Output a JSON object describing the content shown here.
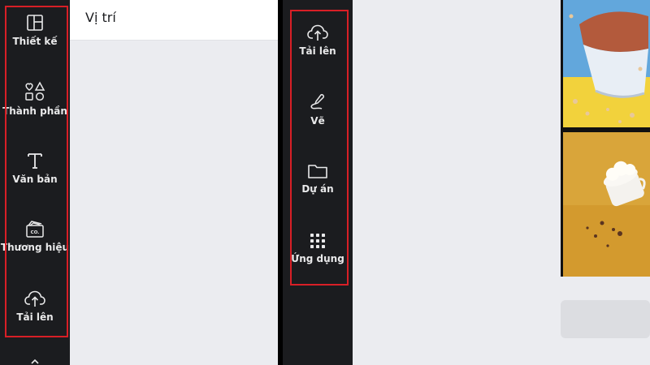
{
  "left_panel": {
    "rail_items": [
      {
        "label": "Thiết kế",
        "icon": "layout-icon"
      },
      {
        "label": "Thành phần",
        "icon": "shapes-icon"
      },
      {
        "label": "Văn bản",
        "icon": "text-icon"
      },
      {
        "label": "Thương hiệu",
        "icon": "brand-icon"
      },
      {
        "label": "Tải lên",
        "icon": "upload-cloud-icon"
      }
    ],
    "location_title": "Vị trí"
  },
  "right_panel": {
    "rail_items": [
      {
        "label": "Tải lên",
        "icon": "upload-cloud-icon"
      },
      {
        "label": "Vẽ",
        "icon": "draw-icon"
      },
      {
        "label": "Dự án",
        "icon": "folder-icon"
      },
      {
        "label": "Ứng dụng",
        "icon": "apps-grid-icon"
      }
    ]
  },
  "colors": {
    "rail_bg": "#1b1c1f",
    "highlight_border": "#d81f26",
    "canvas_bg": "#ebecf0"
  }
}
